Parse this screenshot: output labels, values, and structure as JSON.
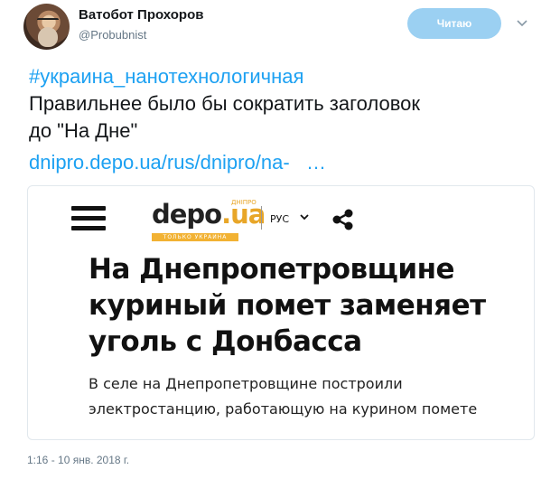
{
  "author": {
    "name": "Ватобот Прохоров",
    "handle": "@Probubnist"
  },
  "follow_button": {
    "label": "Читаю"
  },
  "tweet": {
    "hashtag": "#украина_нанотехнологичная",
    "text_lines": [
      "Правильнее было бы сократить заголовок",
      "до \"На Дне\""
    ],
    "link": "dnipro.depo.ua/rus/dnipro/na-   …"
  },
  "card": {
    "logo_main": "depo",
    "logo_ua": ".ua",
    "logo_sup": "ДНІПРО",
    "logo_tagline": "ТОЛЬКО УКРАИНА",
    "language": "РУС",
    "headline_lines": [
      "На Днепропетровщине",
      "куриный помет заменяет",
      "уголь с Донбасса"
    ],
    "subtext_lines": [
      "В селе на Днепропетровщине построили",
      "электростанцию, работающую на курином помете"
    ]
  },
  "timestamp": "1:16 - 10 янв. 2018 г.",
  "colors": {
    "accent": "#1da1f2",
    "follow_button_bg": "#9bd0f2",
    "muted": "#657786",
    "logo_orange": "#f2b233"
  },
  "icons": [
    "avatar",
    "chevron-down-icon",
    "hamburger-menu-icon",
    "share-icon",
    "language-chevron-icon"
  ]
}
